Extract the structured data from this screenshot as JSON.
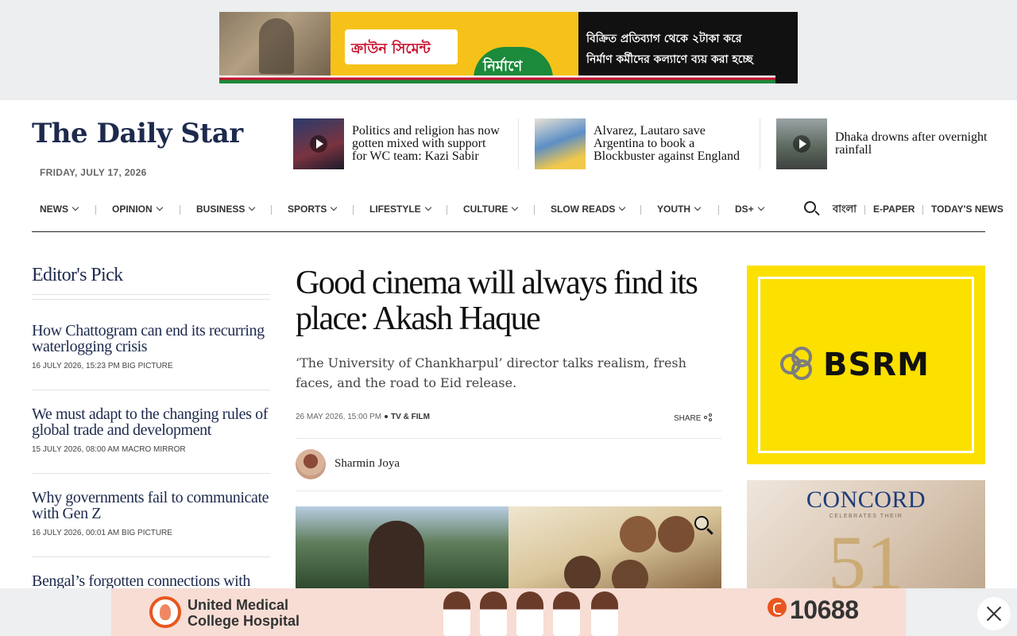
{
  "top_ad": {
    "brand": "ক্রাউন সিমেন্ট",
    "tagline": "নির্মাণে নিরাপত্তা",
    "line1": "বিক্রিত প্রতিব্যাগ থেকে ২টাকা করে",
    "line2": "নির্মাণ কর্মীদের কল্যাণে ব্যয় করা হচ্ছে"
  },
  "header": {
    "logo": "The Daily Star",
    "date": "FRIDAY, JULY 17, 2026",
    "trending": [
      {
        "title": "Politics and religion has now gotten mixed with support for WC team: Kazi Sabir",
        "video": true
      },
      {
        "title": "Alvarez, Lautaro save Argentina to book a Blockbuster against England",
        "video": false
      },
      {
        "title": "Dhaka drowns after overnight rainfall",
        "video": true
      }
    ]
  },
  "nav": {
    "items": [
      "NEWS",
      "OPINION",
      "BUSINESS",
      "SPORTS",
      "LIFESTYLE",
      "CULTURE",
      "SLOW READS",
      "YOUTH",
      "DS+"
    ],
    "bangla": "বাংলা",
    "epaper": "E-PAPER",
    "todays_news": "TODAY'S NEWS"
  },
  "editors_pick": {
    "title": "Editor's Pick",
    "items": [
      {
        "headline": "How Chattogram can end its recurring waterlogging crisis",
        "date": "16 JULY 2026, 15:23 PM",
        "section": "BIG PICTURE"
      },
      {
        "headline": "We must adapt to the changing rules of global trade and development",
        "date": "15 JULY 2026, 08:00 AM",
        "section": "MACRO MIRROR"
      },
      {
        "headline": "Why governments fail to communicate with Gen Z",
        "date": "16 JULY 2026, 00:01 AM",
        "section": "BIG PICTURE"
      },
      {
        "headline": "Bengal’s forgotten connections with"
      }
    ]
  },
  "article": {
    "headline": "Good cinema will always find its place: Akash Haque",
    "standfirst": "‘The University of Chankharpul’ director talks realism, fresh faces, and the road to Eid release.",
    "date": "26 MAY 2026, 15:00 PM",
    "section": "TV & FILM",
    "share": "SHARE",
    "author": "Sharmin Joya"
  },
  "ads": {
    "bsrm": "BSRM",
    "concord_name": "CONCORD",
    "concord_sub": "CELEBRATES THEIR",
    "concord_num": "51",
    "hospital_line1": "United Medical",
    "hospital_line2": "College Hospital",
    "hotline": "10688"
  }
}
